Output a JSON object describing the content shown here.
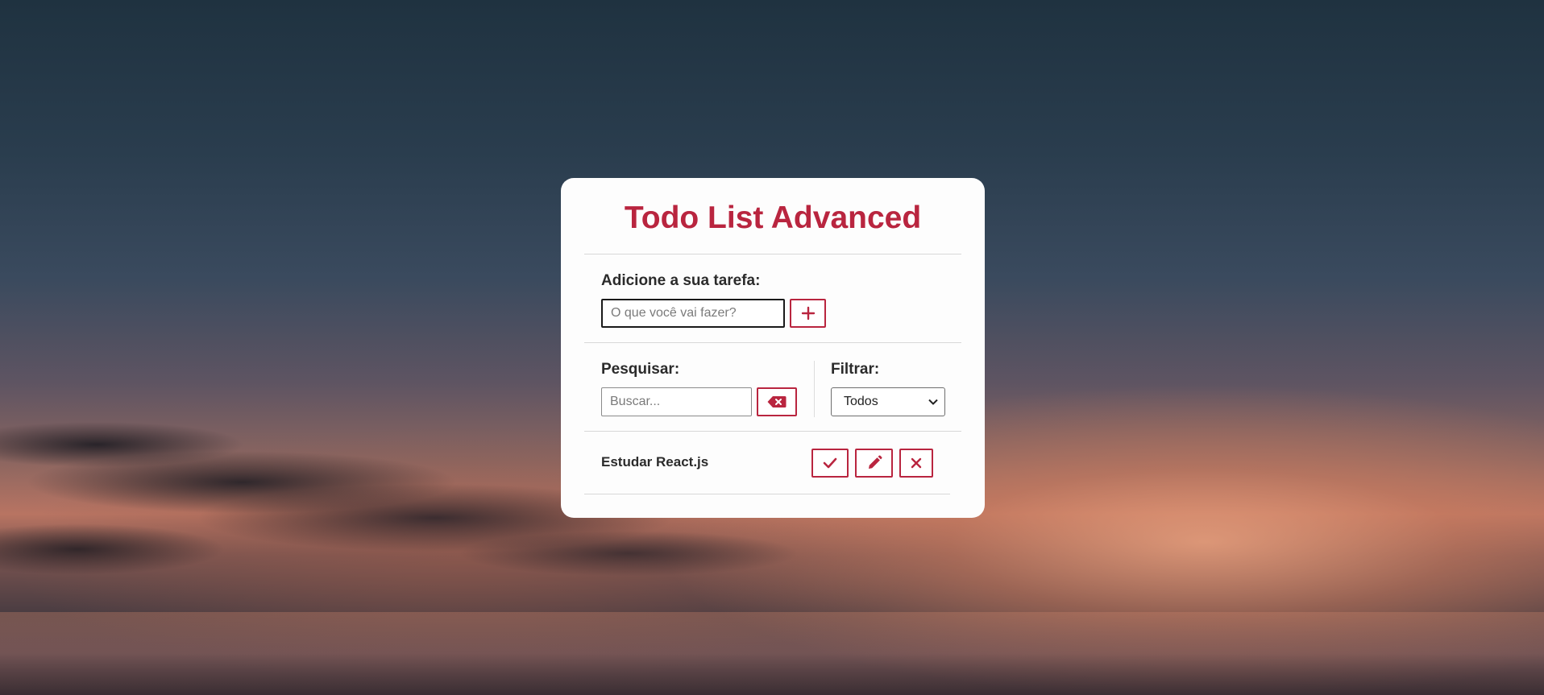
{
  "app": {
    "title": "Todo List Advanced",
    "accent_color": "#b9253f"
  },
  "add_section": {
    "label": "Adicione a sua tarefa:",
    "input_placeholder": "O que você vai fazer?",
    "input_value": "",
    "add_button_icon": "plus-icon"
  },
  "search_section": {
    "label": "Pesquisar:",
    "input_placeholder": "Buscar...",
    "input_value": "",
    "clear_button_icon": "backspace-icon"
  },
  "filter_section": {
    "label": "Filtrar:",
    "selected": "Todos"
  },
  "todos": [
    {
      "text": "Estudar React.js",
      "actions": [
        "check-icon",
        "pencil-icon",
        "x-icon"
      ]
    }
  ]
}
